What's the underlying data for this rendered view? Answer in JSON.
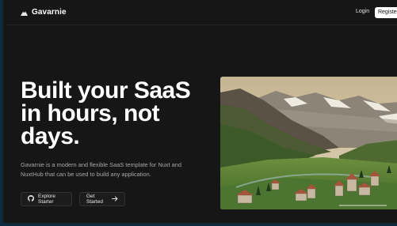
{
  "navbar": {
    "brand_name": "Gavarnie",
    "brand_icon": "mountain-icon",
    "login_label": "Login",
    "register_label": "Register"
  },
  "hero": {
    "headline": "Built your SaaS in hours, not days.",
    "description": "Gavarnie is a modern and flexible SaaS template for Nuxt and NuxtHub that can be used to build any application.",
    "primary_button": {
      "label": "Explore Starter",
      "icon": "github-icon"
    },
    "secondary_button": {
      "label": "Get Started",
      "icon": "arrow-right-icon"
    }
  },
  "colors": {
    "background": "#161616",
    "text": "#ffffff",
    "muted_text": "#a8a8a8",
    "border": "#333333"
  }
}
